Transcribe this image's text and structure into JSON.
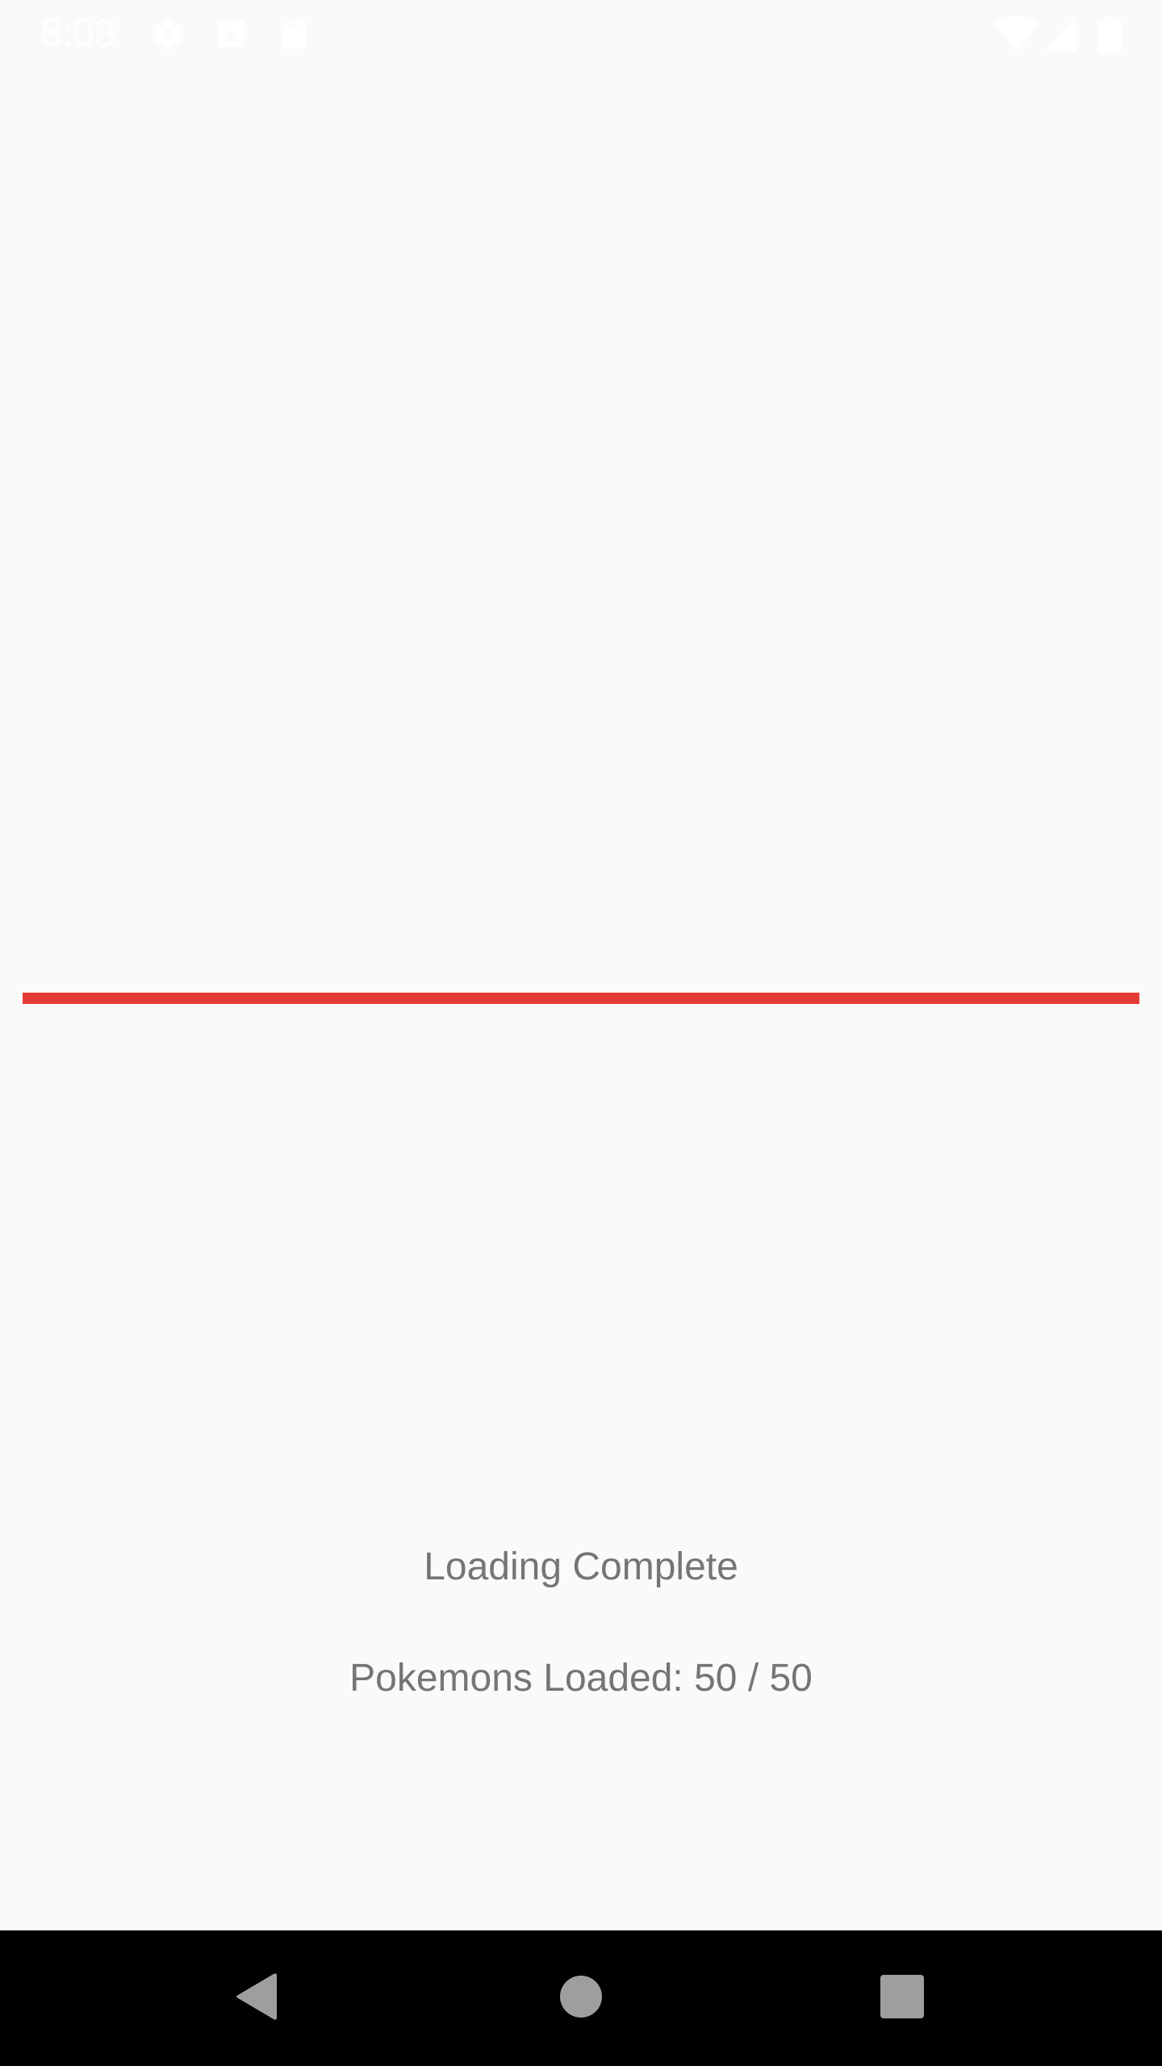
{
  "status_bar": {
    "time": "8:03",
    "left_icons": [
      "gear-icon",
      "drive-icon",
      "sd-card-icon"
    ],
    "right_icons": [
      "wifi-icon",
      "cell-signal-icon",
      "battery-icon"
    ]
  },
  "progress": {
    "value": 1.0,
    "color": "#e53935",
    "track_color": "#f3d0d0"
  },
  "status_text": "Loading Complete",
  "count_text": "Pokemons Loaded: 50 / 50",
  "nav_bar": {
    "buttons": [
      "back-icon",
      "home-icon",
      "recents-icon"
    ]
  }
}
